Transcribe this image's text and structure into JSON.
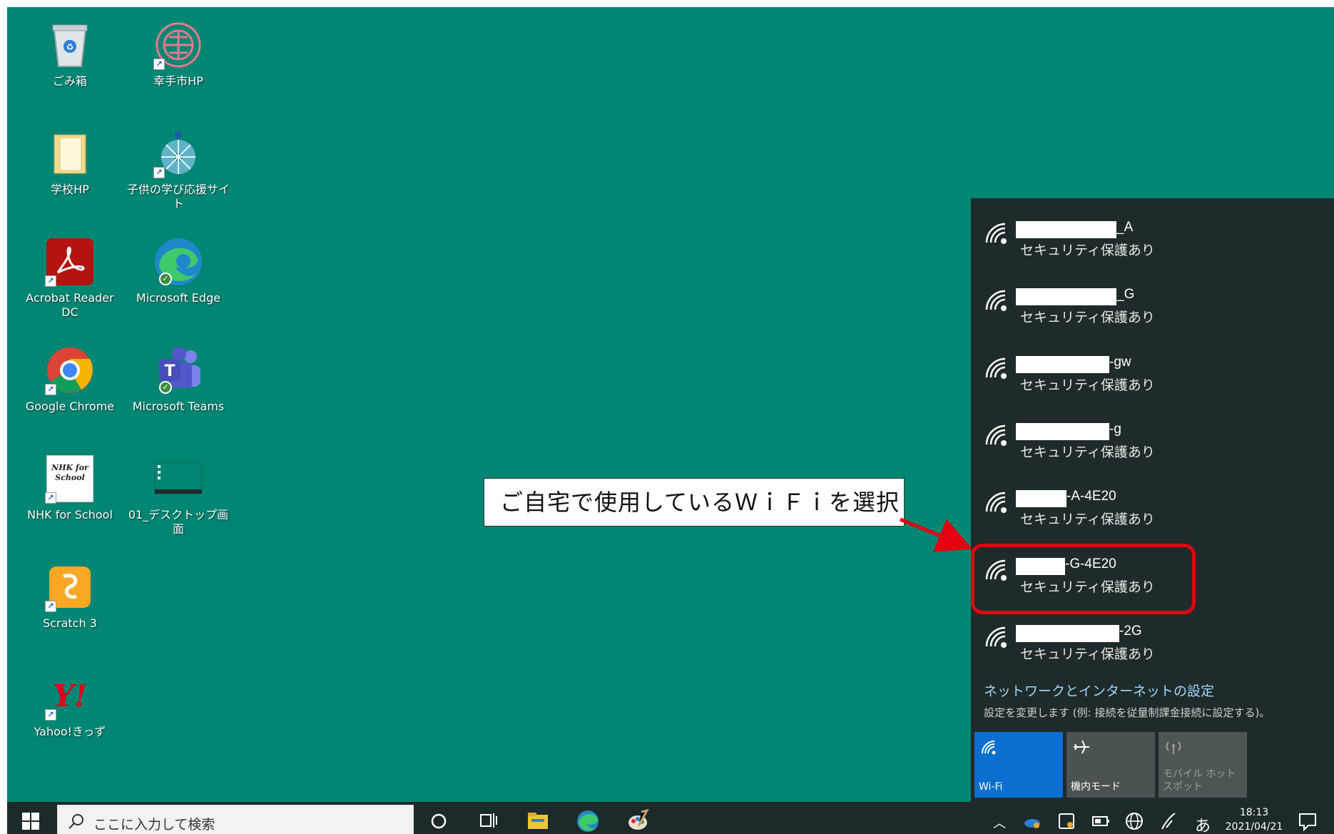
{
  "desktop": {
    "icons": [
      {
        "label": "ごみ箱"
      },
      {
        "label": "幸手市HP"
      },
      {
        "label": "学校HP"
      },
      {
        "label": "子供の学び応援サイト"
      },
      {
        "label": "Acrobat Reader DC"
      },
      {
        "label": "Microsoft Edge"
      },
      {
        "label": "Google Chrome"
      },
      {
        "label": "Microsoft Teams"
      },
      {
        "label": "NHK for School"
      },
      {
        "label": "01_デスクトップ画面"
      },
      {
        "label": "Scratch 3"
      },
      {
        "label": "Yahoo!きっず"
      }
    ],
    "nhk_logo_text": "NHK for School",
    "yahoo_logo_text": "Y!"
  },
  "callout": {
    "text": "ご自宅で使用しているＷｉＦｉを選択"
  },
  "wifi": {
    "networks": [
      {
        "ssid_suffix": "_A",
        "security": "セキュリティ保護あり"
      },
      {
        "ssid_suffix": "_G",
        "security": "セキュリティ保護あり"
      },
      {
        "ssid_suffix": "-gw",
        "security": "セキュリティ保護あり"
      },
      {
        "ssid_suffix": "-g",
        "security": "セキュリティ保護あり"
      },
      {
        "ssid_suffix": "-A-4E20",
        "security": "セキュリティ保護あり"
      },
      {
        "ssid_suffix": "-G-4E20",
        "security": "セキュリティ保護あり"
      },
      {
        "ssid_suffix": "-2G",
        "security": "セキュリティ保護あり"
      }
    ],
    "settings_link": "ネットワークとインターネットの設定",
    "settings_desc": "設定を変更します (例: 接続を従量制課金接続に設定する)。",
    "tiles": [
      {
        "label": "Wi-Fi",
        "state": "on"
      },
      {
        "label": "機内モード",
        "state": "normal"
      },
      {
        "label": "モバイル ホットスポット",
        "state": "disabled"
      }
    ],
    "colors": {
      "active_tile": "#0a6fd1",
      "highlight": "#e3000f"
    }
  },
  "taskbar": {
    "search_placeholder": "ここに入力して検索",
    "ime": "あ",
    "time": "18:13",
    "date": "2021/04/21"
  }
}
